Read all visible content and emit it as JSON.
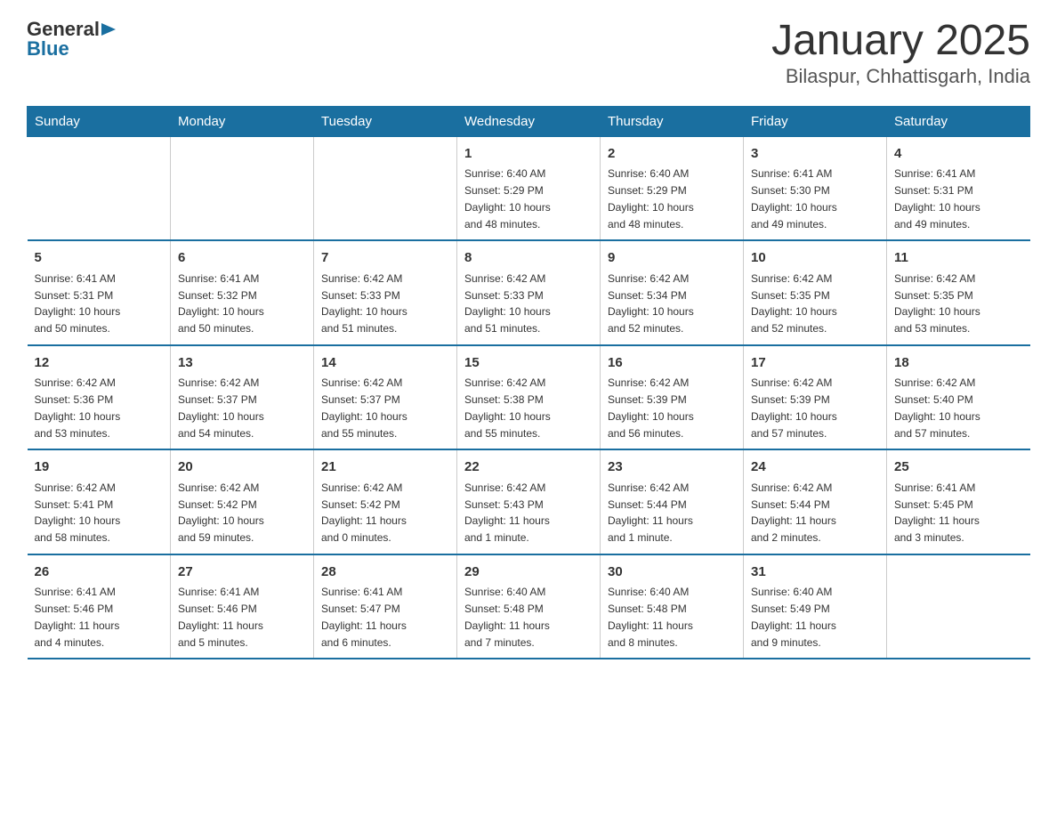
{
  "logo": {
    "general": "General",
    "blue": "Blue"
  },
  "title": "January 2025",
  "subtitle": "Bilaspur, Chhattisgarh, India",
  "headers": [
    "Sunday",
    "Monday",
    "Tuesday",
    "Wednesday",
    "Thursday",
    "Friday",
    "Saturday"
  ],
  "weeks": [
    [
      {
        "day": "",
        "info": ""
      },
      {
        "day": "",
        "info": ""
      },
      {
        "day": "",
        "info": ""
      },
      {
        "day": "1",
        "info": "Sunrise: 6:40 AM\nSunset: 5:29 PM\nDaylight: 10 hours\nand 48 minutes."
      },
      {
        "day": "2",
        "info": "Sunrise: 6:40 AM\nSunset: 5:29 PM\nDaylight: 10 hours\nand 48 minutes."
      },
      {
        "day": "3",
        "info": "Sunrise: 6:41 AM\nSunset: 5:30 PM\nDaylight: 10 hours\nand 49 minutes."
      },
      {
        "day": "4",
        "info": "Sunrise: 6:41 AM\nSunset: 5:31 PM\nDaylight: 10 hours\nand 49 minutes."
      }
    ],
    [
      {
        "day": "5",
        "info": "Sunrise: 6:41 AM\nSunset: 5:31 PM\nDaylight: 10 hours\nand 50 minutes."
      },
      {
        "day": "6",
        "info": "Sunrise: 6:41 AM\nSunset: 5:32 PM\nDaylight: 10 hours\nand 50 minutes."
      },
      {
        "day": "7",
        "info": "Sunrise: 6:42 AM\nSunset: 5:33 PM\nDaylight: 10 hours\nand 51 minutes."
      },
      {
        "day": "8",
        "info": "Sunrise: 6:42 AM\nSunset: 5:33 PM\nDaylight: 10 hours\nand 51 minutes."
      },
      {
        "day": "9",
        "info": "Sunrise: 6:42 AM\nSunset: 5:34 PM\nDaylight: 10 hours\nand 52 minutes."
      },
      {
        "day": "10",
        "info": "Sunrise: 6:42 AM\nSunset: 5:35 PM\nDaylight: 10 hours\nand 52 minutes."
      },
      {
        "day": "11",
        "info": "Sunrise: 6:42 AM\nSunset: 5:35 PM\nDaylight: 10 hours\nand 53 minutes."
      }
    ],
    [
      {
        "day": "12",
        "info": "Sunrise: 6:42 AM\nSunset: 5:36 PM\nDaylight: 10 hours\nand 53 minutes."
      },
      {
        "day": "13",
        "info": "Sunrise: 6:42 AM\nSunset: 5:37 PM\nDaylight: 10 hours\nand 54 minutes."
      },
      {
        "day": "14",
        "info": "Sunrise: 6:42 AM\nSunset: 5:37 PM\nDaylight: 10 hours\nand 55 minutes."
      },
      {
        "day": "15",
        "info": "Sunrise: 6:42 AM\nSunset: 5:38 PM\nDaylight: 10 hours\nand 55 minutes."
      },
      {
        "day": "16",
        "info": "Sunrise: 6:42 AM\nSunset: 5:39 PM\nDaylight: 10 hours\nand 56 minutes."
      },
      {
        "day": "17",
        "info": "Sunrise: 6:42 AM\nSunset: 5:39 PM\nDaylight: 10 hours\nand 57 minutes."
      },
      {
        "day": "18",
        "info": "Sunrise: 6:42 AM\nSunset: 5:40 PM\nDaylight: 10 hours\nand 57 minutes."
      }
    ],
    [
      {
        "day": "19",
        "info": "Sunrise: 6:42 AM\nSunset: 5:41 PM\nDaylight: 10 hours\nand 58 minutes."
      },
      {
        "day": "20",
        "info": "Sunrise: 6:42 AM\nSunset: 5:42 PM\nDaylight: 10 hours\nand 59 minutes."
      },
      {
        "day": "21",
        "info": "Sunrise: 6:42 AM\nSunset: 5:42 PM\nDaylight: 11 hours\nand 0 minutes."
      },
      {
        "day": "22",
        "info": "Sunrise: 6:42 AM\nSunset: 5:43 PM\nDaylight: 11 hours\nand 1 minute."
      },
      {
        "day": "23",
        "info": "Sunrise: 6:42 AM\nSunset: 5:44 PM\nDaylight: 11 hours\nand 1 minute."
      },
      {
        "day": "24",
        "info": "Sunrise: 6:42 AM\nSunset: 5:44 PM\nDaylight: 11 hours\nand 2 minutes."
      },
      {
        "day": "25",
        "info": "Sunrise: 6:41 AM\nSunset: 5:45 PM\nDaylight: 11 hours\nand 3 minutes."
      }
    ],
    [
      {
        "day": "26",
        "info": "Sunrise: 6:41 AM\nSunset: 5:46 PM\nDaylight: 11 hours\nand 4 minutes."
      },
      {
        "day": "27",
        "info": "Sunrise: 6:41 AM\nSunset: 5:46 PM\nDaylight: 11 hours\nand 5 minutes."
      },
      {
        "day": "28",
        "info": "Sunrise: 6:41 AM\nSunset: 5:47 PM\nDaylight: 11 hours\nand 6 minutes."
      },
      {
        "day": "29",
        "info": "Sunrise: 6:40 AM\nSunset: 5:48 PM\nDaylight: 11 hours\nand 7 minutes."
      },
      {
        "day": "30",
        "info": "Sunrise: 6:40 AM\nSunset: 5:48 PM\nDaylight: 11 hours\nand 8 minutes."
      },
      {
        "day": "31",
        "info": "Sunrise: 6:40 AM\nSunset: 5:49 PM\nDaylight: 11 hours\nand 9 minutes."
      },
      {
        "day": "",
        "info": ""
      }
    ]
  ]
}
